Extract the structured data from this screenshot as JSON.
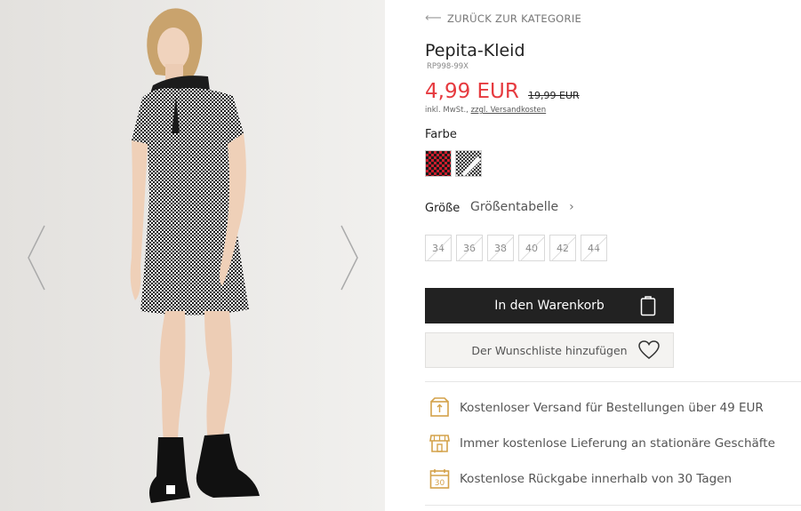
{
  "nav": {
    "back_label": "ZURÜCK ZUR KATEGORIE",
    "back_icon": "arrow-left-icon"
  },
  "product": {
    "title": "Pepita-Kleid",
    "sku": "RP998-99X",
    "price": "4,99 EUR",
    "old_price": "19,99 EUR",
    "tax_prefix": "inkl. MwSt., ",
    "shipping_link": "zzgl. Versandkosten",
    "price_color": "#e63a3f"
  },
  "color": {
    "label": "Farbe",
    "swatches": [
      {
        "name": "red-black-houndstooth",
        "color": "#cc1f2e"
      },
      {
        "name": "black-white-houndstooth",
        "color": "#ffffff"
      }
    ]
  },
  "size": {
    "label": "Größe",
    "chart_label": "Größentabelle",
    "options": [
      {
        "label": "34",
        "available": false
      },
      {
        "label": "36",
        "available": false
      },
      {
        "label": "38",
        "available": false
      },
      {
        "label": "40",
        "available": false
      },
      {
        "label": "42",
        "available": false
      },
      {
        "label": "44",
        "available": false
      }
    ]
  },
  "actions": {
    "cart_label": "In den Warenkorb",
    "wishlist_label": "Der Wunschliste hinzufügen"
  },
  "benefits": [
    {
      "icon": "box-icon",
      "text": "Kostenloser Versand für Bestellungen über 49 EUR"
    },
    {
      "icon": "store-icon",
      "text": "Immer kostenlose Lieferung an stationäre Geschäfte"
    },
    {
      "icon": "calendar-30-icon",
      "text": "Kostenlose Rückgabe innerhalb von 30 Tagen"
    }
  ],
  "colors": {
    "accent": "#e63a3f",
    "button_dark": "#222222",
    "icon_gold": "#d4a24a"
  }
}
